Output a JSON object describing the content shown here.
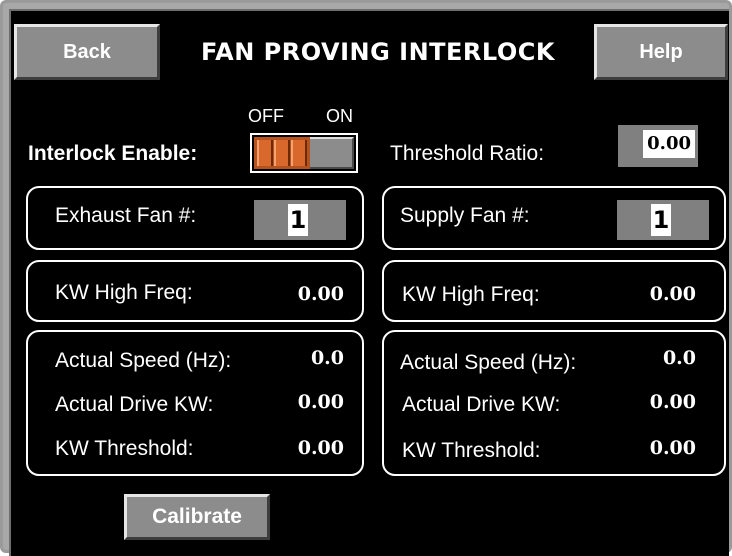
{
  "header": {
    "back_label": "Back",
    "title": "FAN PROVING INTERLOCK",
    "help_label": "Help"
  },
  "interlock": {
    "label": "Interlock Enable:",
    "off_label": "OFF",
    "on_label": "ON",
    "state": "OFF"
  },
  "threshold_ratio": {
    "label": "Threshold Ratio:",
    "value": "0.00"
  },
  "exhaust": {
    "fan_label": "Exhaust Fan #:",
    "fan_number": "1",
    "kw_high_freq_label": "KW  High Freq:",
    "kw_high_freq_value": "0.00",
    "actual_speed_label": "Actual Speed (Hz):",
    "actual_speed_value": "0.0",
    "actual_drive_kw_label": "Actual Drive KW:",
    "actual_drive_kw_value": "0.00",
    "kw_threshold_label": "KW Threshold:",
    "kw_threshold_value": "0.00"
  },
  "supply": {
    "fan_label": "Supply Fan #:",
    "fan_number": "1",
    "kw_high_freq_label": "KW  High Freq:",
    "kw_high_freq_value": "0.00",
    "actual_speed_label": "Actual Speed (Hz):",
    "actual_speed_value": "0.0",
    "actual_drive_kw_label": "Actual Drive KW:",
    "actual_drive_kw_value": "0.00",
    "kw_threshold_label": "KW Threshold:",
    "kw_threshold_value": "0.00"
  },
  "footer": {
    "calibrate_label": "Calibrate"
  },
  "colors": {
    "background": "#000000",
    "button": "#8c8c8c",
    "toggle_knob": "#b5521e",
    "field": "#808080"
  }
}
